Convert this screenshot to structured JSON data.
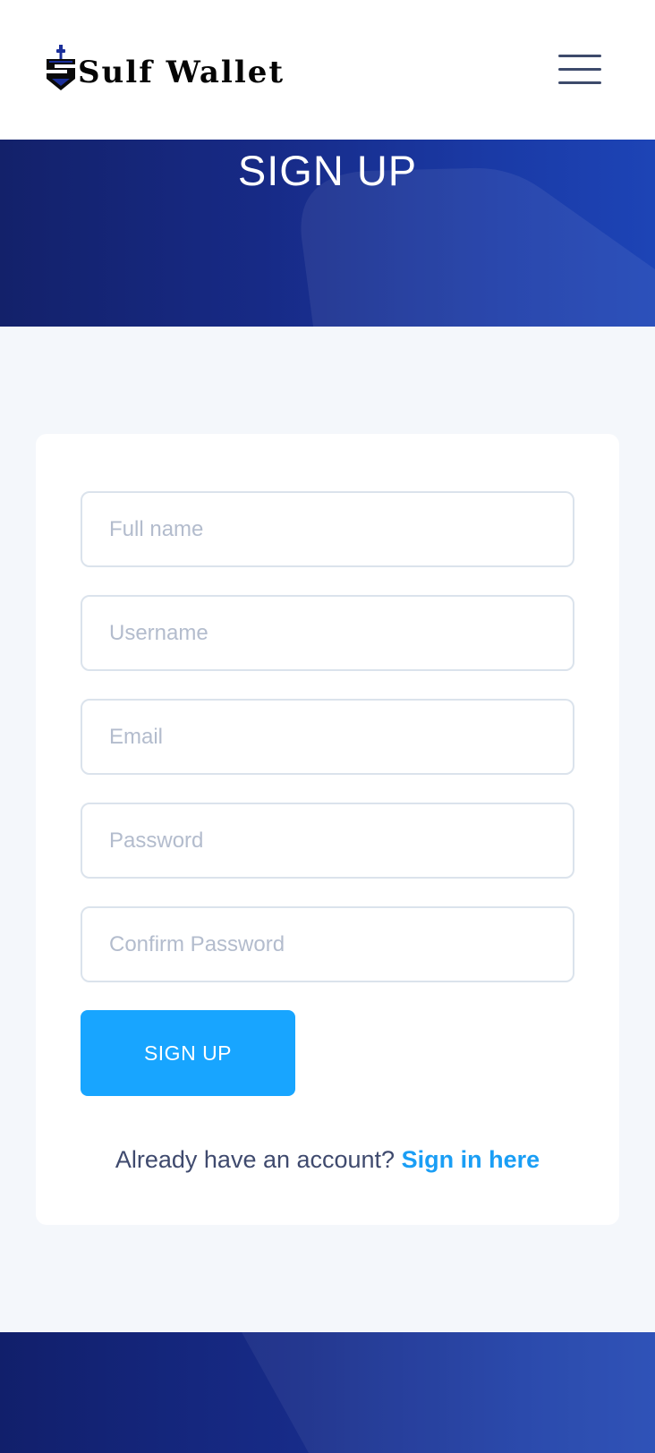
{
  "header": {
    "brand_name": "Sulf Wallet",
    "logo_icon": "shield-sword-logo",
    "menu_icon": "hamburger-menu-icon"
  },
  "hero": {
    "title": "SIGN UP"
  },
  "form": {
    "fields": [
      {
        "name": "full-name",
        "placeholder": "Full name",
        "value": ""
      },
      {
        "name": "username",
        "placeholder": "Username",
        "value": ""
      },
      {
        "name": "email",
        "placeholder": "Email",
        "value": ""
      },
      {
        "name": "password",
        "placeholder": "Password",
        "value": ""
      },
      {
        "name": "confirm-password",
        "placeholder": "Confirm Password",
        "value": ""
      }
    ],
    "submit_label": "SIGN UP",
    "signin_prompt": "Already have an account?",
    "signin_link": "Sign in here"
  },
  "colors": {
    "hero_gradient_start": "#13216a",
    "hero_gradient_end": "#1d44b6",
    "accent": "#18a5ff",
    "link": "#1a9ef5",
    "page_background": "#f4f7fb"
  }
}
